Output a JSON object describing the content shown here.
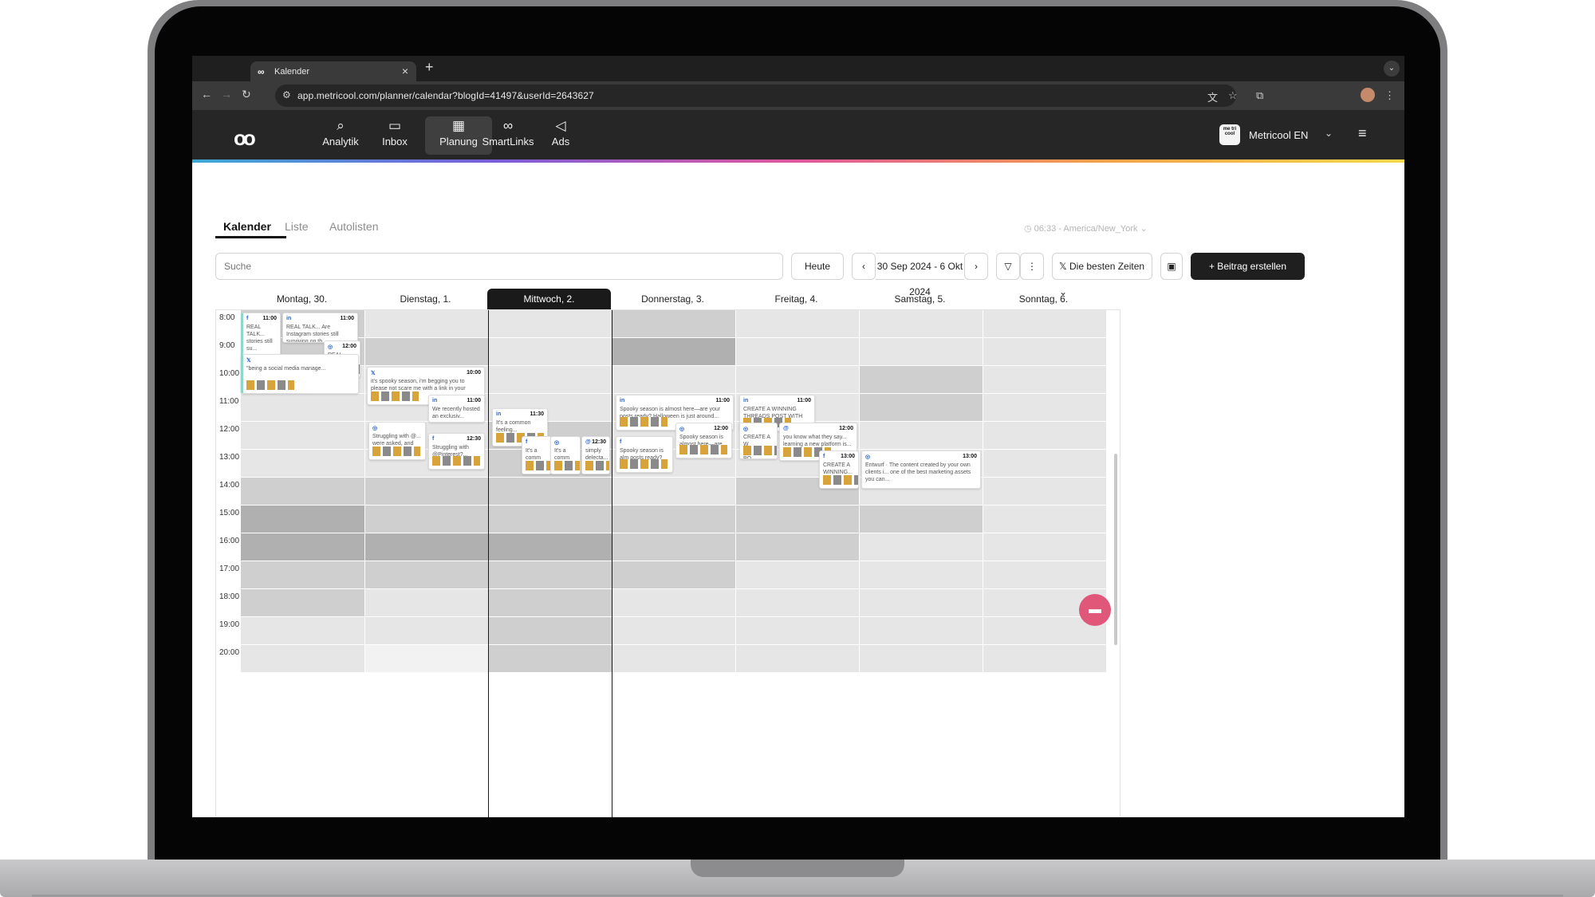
{
  "browser": {
    "tab_title": "Kalender",
    "url": "app.metricool.com/planner/calendar?blogId=41497&userId=2643627"
  },
  "app": {
    "nav": [
      {
        "label": "Analytik",
        "icon": "analytics-icon"
      },
      {
        "label": "Inbox",
        "icon": "inbox-icon"
      },
      {
        "label": "Planung",
        "icon": "calendar-icon"
      },
      {
        "label": "SmartLinks",
        "icon": "link-icon"
      },
      {
        "label": "Ads",
        "icon": "megaphone-icon"
      }
    ],
    "active_nav": "Planung",
    "account_name": "Metricool EN",
    "account_badge": "me tri cool"
  },
  "views": {
    "calendar": "Kalender",
    "list": "Liste",
    "autolists": "Autolisten",
    "active": "Kalender"
  },
  "timezone": "06:33 - America/New_York",
  "controls": {
    "search_placeholder": "Suche",
    "today": "Heute",
    "date_range": "30 Sep 2024 - 6 Okt 2024",
    "best_times": "Die besten Zeiten",
    "create": "+ Beitrag erstellen"
  },
  "calendar": {
    "days": [
      "Montag, 30.",
      "Dienstag, 1.",
      "Mittwoch, 2.",
      "Donnerstag, 3.",
      "Freitag, 4.",
      "Samstag, 5.",
      "Sonntag, 6."
    ],
    "active_day": 2,
    "hours": [
      "8:00",
      "9:00",
      "10:00",
      "11:00",
      "12:00",
      "13:00",
      "14:00",
      "15:00",
      "16:00",
      "17:00",
      "18:00",
      "19:00",
      "20:00"
    ],
    "posts": [
      {
        "day": 0,
        "time": "11:00",
        "network": "f",
        "text": "REAL TALK... stories still su..."
      },
      {
        "day": 0,
        "time": "11:00",
        "network": "in",
        "text": "REAL TALK... Are Instagram stories still surviving on th..."
      },
      {
        "day": 0,
        "time": "12:00",
        "network": "ig",
        "text": "REAL TALK... Are..."
      },
      {
        "day": 0,
        "time": "",
        "network": "X",
        "text": "\"being a social media manage..."
      },
      {
        "day": 1,
        "time": "10:00",
        "network": "X",
        "text": "it's spooky season, i'm begging you to please not scare me with a link in your instagram caption."
      },
      {
        "day": 1,
        "time": "11:00",
        "network": "in",
        "text": "We recently hosted an exclusiv..."
      },
      {
        "day": 1,
        "time": "",
        "network": "ig",
        "text": "Struggling with @... were asked, and we g..."
      },
      {
        "day": 1,
        "time": "12:30",
        "network": "f",
        "text": "Struggling with @Pinterest?..."
      },
      {
        "day": 2,
        "time": "11:30",
        "network": "in",
        "text": "It's a common feeling..."
      },
      {
        "day": 2,
        "time": "",
        "network": "f",
        "text": "It's a comm feeling..."
      },
      {
        "day": 2,
        "time": "",
        "network": "ig",
        "text": "It's a comm feeling..."
      },
      {
        "day": 2,
        "time": "12:30",
        "network": "th",
        "text": "simply delecta..."
      },
      {
        "day": 3,
        "time": "11:00",
        "network": "in",
        "text": "Spooky season is almost here—are your posts ready? Halloween is just around..."
      },
      {
        "day": 3,
        "time": "12:00",
        "network": "ig",
        "text": "Spooky season is almost here—are..."
      },
      {
        "day": 3,
        "time": "",
        "network": "f",
        "text": "Spooky season is alm posts ready? Hallo..."
      },
      {
        "day": 4,
        "time": "11:00",
        "network": "in",
        "text": "CREATE A WINNING THREADS POST WITH U..."
      },
      {
        "day": 4,
        "time": "",
        "network": "ig",
        "text": "CREATE A W THREADS PO..."
      },
      {
        "day": 4,
        "time": "12:00",
        "network": "th",
        "text": "you know what they say... learning a new platform is..."
      },
      {
        "day": 4,
        "time": "13:00",
        "network": "f",
        "text": "CREATE A WINNING..."
      },
      {
        "day": 5,
        "time": "13:00",
        "network": "draft",
        "text": "Entwurf · The content created by your own clients i... one of the best marketing assets you can..."
      }
    ]
  },
  "colors": {
    "accent": "#e0577a",
    "dark": "#1f1f1f",
    "cell_shade_light": "#e6e6e6",
    "cell_shade_mid": "#cfcfcf",
    "cell_shade_dark": "#b0b0b0"
  }
}
